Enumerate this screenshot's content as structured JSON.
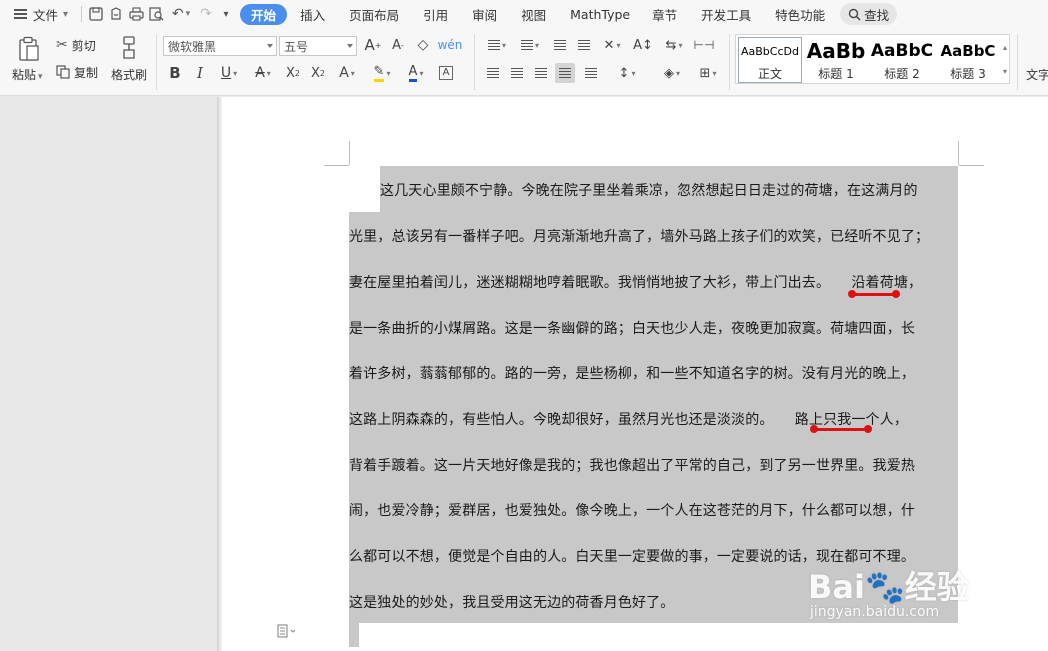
{
  "menubar": {
    "file": "文件",
    "tabs": [
      "开始",
      "插入",
      "页面布局",
      "引用",
      "审阅",
      "视图",
      "MathType",
      "章节",
      "开发工具",
      "特色功能"
    ],
    "search": "查找"
  },
  "ribbon": {
    "paste": "粘贴",
    "cut": "剪切",
    "copy": "复制",
    "format_painter": "格式刷",
    "font_name": "微软雅黑",
    "font_size": "五号",
    "styles": [
      {
        "preview": "AaBbCcDd",
        "name": "正文"
      },
      {
        "preview": "AaBb",
        "name": "标题 1"
      },
      {
        "preview": "AaBbC",
        "name": "标题 2"
      },
      {
        "preview": "AaBbC",
        "name": "标题 3"
      }
    ],
    "text_tool": "文字"
  },
  "document": {
    "lines": [
      "这几天心里颇不宁静。今晚在院子里坐着乘凉，忽然想起日日走过的荷塘，在这满月的",
      "光里，总该另有一番样子吧。月亮渐渐地升高了，墙外马路上孩子们的欢笑，已经听不见了；",
      "妻在屋里拍着闰儿，迷迷糊糊地哼着眠歌。我悄悄地披了大衫，带上门出去。　　沿着荷塘，",
      "是一条曲折的小煤屑路。这是一条幽僻的路；白天也少人走，夜晚更加寂寞。荷塘四面，长",
      "着许多树，蓊蓊郁郁的。路的一旁，是些杨柳，和一些不知道名字的树。没有月光的晚上，",
      "这路上阴森森的，有些怕人。今晚却很好，虽然月光也还是淡淡的。　　路上只我一个人，",
      "背着手踱着。这一片天地好像是我的；我也像超出了平常的自己，到了另一世界里。我爱热",
      "闹，也爱冷静；爱群居，也爱独处。像今晚上，一个人在这苍茫的月下，什么都可以想，什",
      "么都可以不想，便觉是个自由的人。白天里一定要做的事，一定要说的话，现在都可不理。",
      "这是独处的妙处，我且受用这无边的荷香月色好了。"
    ]
  },
  "watermark": {
    "logo": "Bai🐾经验",
    "url": "jingyan.baidu.com"
  },
  "colors": {
    "accent": "#4a8ef0",
    "selection": "#c8c8c8",
    "annotation": "#dd1111"
  }
}
